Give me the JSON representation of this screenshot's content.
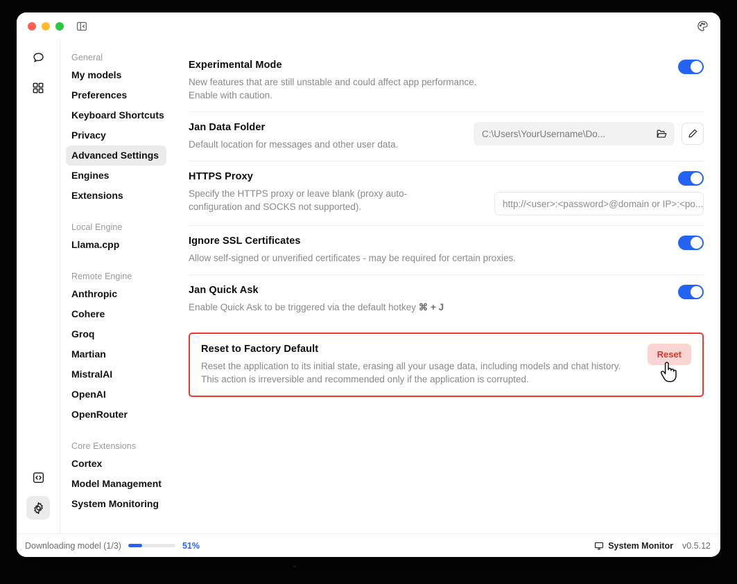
{
  "titlebar": {
    "traffic_lights": [
      "close",
      "minimize",
      "maximize"
    ],
    "panel_toggle_icon": "panel-left-collapse-icon",
    "theme_icon": "palette-icon"
  },
  "rail": {
    "items": [
      {
        "icon": "chat-bubble-icon",
        "active": false
      },
      {
        "icon": "grid-apps-icon",
        "active": false
      }
    ],
    "bottom_items": [
      {
        "icon": "code-brackets-icon",
        "active": false
      },
      {
        "icon": "gear-icon",
        "active": true
      }
    ]
  },
  "nav": {
    "groups": [
      {
        "label": "General",
        "items": [
          {
            "label": "My models",
            "selected": false
          },
          {
            "label": "Preferences",
            "selected": false
          },
          {
            "label": "Keyboard Shortcuts",
            "selected": false
          },
          {
            "label": "Privacy",
            "selected": false
          },
          {
            "label": "Advanced Settings",
            "selected": true
          },
          {
            "label": "Engines",
            "selected": false
          },
          {
            "label": "Extensions",
            "selected": false
          }
        ]
      },
      {
        "label": "Local Engine",
        "items": [
          {
            "label": "Llama.cpp",
            "selected": false
          }
        ]
      },
      {
        "label": "Remote Engine",
        "items": [
          {
            "label": "Anthropic",
            "selected": false
          },
          {
            "label": "Cohere",
            "selected": false
          },
          {
            "label": "Groq",
            "selected": false
          },
          {
            "label": "Martian",
            "selected": false
          },
          {
            "label": "MistralAI",
            "selected": false
          },
          {
            "label": "OpenAI",
            "selected": false
          },
          {
            "label": "OpenRouter",
            "selected": false
          }
        ]
      },
      {
        "label": "Core Extensions",
        "items": [
          {
            "label": "Cortex",
            "selected": false
          },
          {
            "label": "Model Management",
            "selected": false
          },
          {
            "label": "System Monitoring",
            "selected": false
          }
        ]
      }
    ]
  },
  "settings": {
    "experimental": {
      "title": "Experimental Mode",
      "desc": "New features that are still unstable and could affect app performance. Enable with caution.",
      "toggle_on": true
    },
    "data_folder": {
      "title": "Jan Data Folder",
      "desc": "Default location for messages and other user data.",
      "path": "C:\\Users\\YourUsername\\Do...",
      "folder_icon": "folder-open-icon",
      "edit_icon": "pencil-icon"
    },
    "https_proxy": {
      "title": "HTTPS Proxy",
      "desc": "Specify the HTTPS proxy or leave blank (proxy auto-configuration and SOCKS not supported).",
      "placeholder": "http://<user>:<password>@domain or IP>:<po...",
      "value": "",
      "toggle_on": true
    },
    "ignore_ssl": {
      "title": "Ignore SSL Certificates",
      "desc": "Allow self-signed or unverified certificates - may be required for certain proxies.",
      "toggle_on": true
    },
    "quick_ask": {
      "title": "Jan Quick Ask",
      "desc_prefix": "Enable Quick Ask to be triggered via the default hotkey ",
      "hotkey": "⌘ + J",
      "toggle_on": true
    },
    "reset": {
      "title": "Reset to Factory Default",
      "desc": "Reset the application to its initial state, erasing all your usage data, including models and chat history. This action is irreversible and recommended only if the application is corrupted.",
      "button_label": "Reset",
      "highlight_color": "#f5352b",
      "button_bg": "#fbd4d4",
      "button_fg": "#e0352b"
    }
  },
  "statusbar": {
    "download_label": "Downloading model (1/3)",
    "download_percent": "51%",
    "download_progress": 30,
    "system_monitor_label": "System Monitor",
    "system_monitor_icon": "monitor-icon",
    "version": "v0.5.12"
  },
  "colors": {
    "accent": "#2563f5",
    "danger": "#f5352b"
  }
}
